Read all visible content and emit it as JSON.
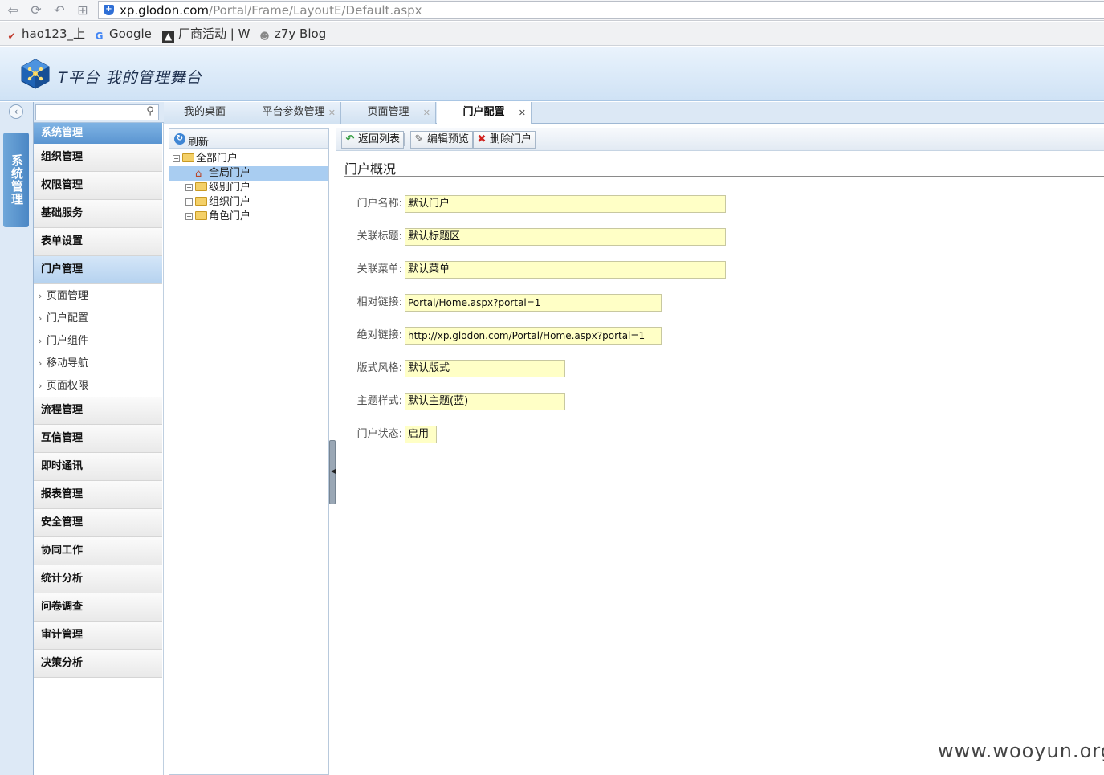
{
  "browser": {
    "url_host": "xp.glodon.com",
    "url_path": "/Portal/Frame/LayoutE/Default.aspx",
    "bookmarks": [
      "hao123_上",
      "Google",
      "厂商活动 | W",
      "z7y Blog"
    ]
  },
  "header": {
    "title": "T平台 我的管理舞台"
  },
  "nav": {
    "vertical_tab": "系统管理"
  },
  "search": {
    "placeholder": ""
  },
  "sidebar": {
    "heading": "系统管理",
    "groups": [
      "组织管理",
      "权限管理",
      "基础服务",
      "表单设置",
      "门户管理"
    ],
    "sub_items": [
      "页面管理",
      "门户配置",
      "门户组件",
      "移动导航",
      "页面权限"
    ],
    "more_groups": [
      "流程管理",
      "互信管理",
      "即时通讯",
      "报表管理",
      "安全管理",
      "协同工作",
      "统计分析",
      "问卷调查",
      "审计管理",
      "决策分析"
    ]
  },
  "tabs": [
    {
      "label": "我的桌面"
    },
    {
      "label": "平台参数管理"
    },
    {
      "label": "页面管理"
    },
    {
      "label": "门户配置"
    }
  ],
  "tree": {
    "refresh_label": "刷新",
    "root": "全部门户",
    "nodes": [
      "全局门户",
      "级别门户",
      "组织门户",
      "角色门户"
    ]
  },
  "toolbar": {
    "back_label": "返回列表",
    "edit_label": "编辑预览",
    "delete_label": "删除门户"
  },
  "form": {
    "section_title": "门户概况",
    "fields": [
      {
        "label": "门户名称:",
        "value": "默认门户"
      },
      {
        "label": "关联标题:",
        "value": "默认标题区"
      },
      {
        "label": "关联菜单:",
        "value": "默认菜单"
      },
      {
        "label": "相对链接:",
        "value": "Portal/Home.aspx?portal=1"
      },
      {
        "label": "绝对链接:",
        "value": "http://xp.glodon.com/Portal/Home.aspx?portal=1"
      },
      {
        "label": "版式风格:",
        "value": "默认版式"
      },
      {
        "label": "主题样式:",
        "value": "默认主题(蓝)"
      },
      {
        "label": "门户状态:",
        "value": "启用"
      }
    ]
  },
  "watermark": "www.wooyun.org"
}
